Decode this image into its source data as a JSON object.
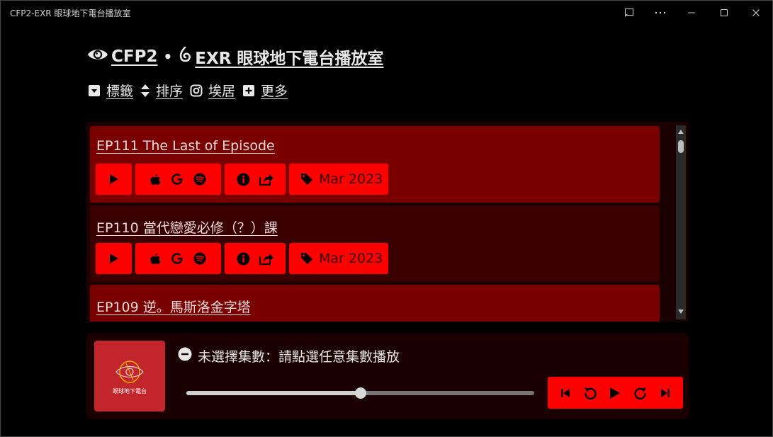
{
  "window": {
    "title": "CFP2-EXR 眼球地下電台播放室"
  },
  "header": {
    "brand": " CFP2",
    "separator": "•",
    "show_title": " EXR 眼球地下電台播放室"
  },
  "nav": [
    {
      "label": "標籤",
      "icon": "caret-square-down-icon"
    },
    {
      "label": "排序",
      "icon": "sort-icon"
    },
    {
      "label": "埃居",
      "icon": "instagram-icon"
    },
    {
      "label": "更多",
      "icon": "plus-square-icon"
    }
  ],
  "episodes": [
    {
      "title": "EP111 The Last of Episode",
      "date": "Mar 2023"
    },
    {
      "title": "EP110 當代戀愛必修（？）課",
      "date": "Mar 2023"
    },
    {
      "title": "EP109 逆。馬斯洛金字塔",
      "date": ""
    }
  ],
  "player": {
    "status": "未選擇集數：請點選任意集數播放",
    "cover_text": "眼球地下電台",
    "progress": 0.5
  },
  "colors": {
    "accent": "#ff0000",
    "active_row": "#7a0000",
    "row": "#3a0000",
    "panel": "#1a0000",
    "cover": "#c2252b"
  }
}
